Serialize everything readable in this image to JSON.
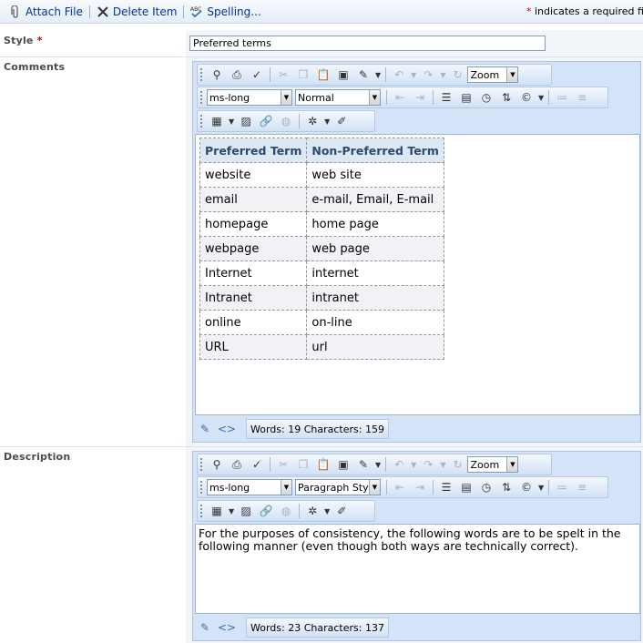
{
  "toolbar": {
    "attach_label": "Attach File",
    "delete_label": "Delete Item",
    "spelling_label": "Spelling...",
    "required_marker": "*",
    "required_note": "indicates a required field"
  },
  "style_field": {
    "label": "Style",
    "required_marker": "*",
    "value": "Preferred terms"
  },
  "comments_field": {
    "label": "Comments",
    "font_name": "ms-long",
    "block_style": "Normal",
    "zoom": "Zoom",
    "table": {
      "headers": [
        "Preferred Term",
        "Non-Preferred Term"
      ],
      "rows": [
        [
          "website",
          "web site"
        ],
        [
          "email",
          "e-mail, Email, E-mail"
        ],
        [
          "homepage",
          "home page"
        ],
        [
          "webpage",
          "web page"
        ],
        [
          "Internet",
          "internet"
        ],
        [
          "Intranet",
          "intranet"
        ],
        [
          "online",
          "on-line"
        ],
        [
          "URL",
          "url"
        ]
      ]
    },
    "status": "Words: 19 Characters: 159"
  },
  "description_field": {
    "label": "Description",
    "font_name": "ms-long",
    "block_style": "Paragraph Style",
    "zoom": "Zoom",
    "text": "For the purposes of consistency, the following words are to be spelt in the following manner (even though both ways are technically correct).",
    "status": "Words: 23 Characters: 137"
  },
  "icons": {
    "attach": "paperclip-icon",
    "delete": "x-icon",
    "spelling": "spellcheck-icon",
    "design_mode": "pencil-icon",
    "html_mode": "code-icon"
  },
  "colors": {
    "accent": "#003399",
    "required": "#cc0000",
    "toolbar_bg": "#d4e3f7"
  }
}
